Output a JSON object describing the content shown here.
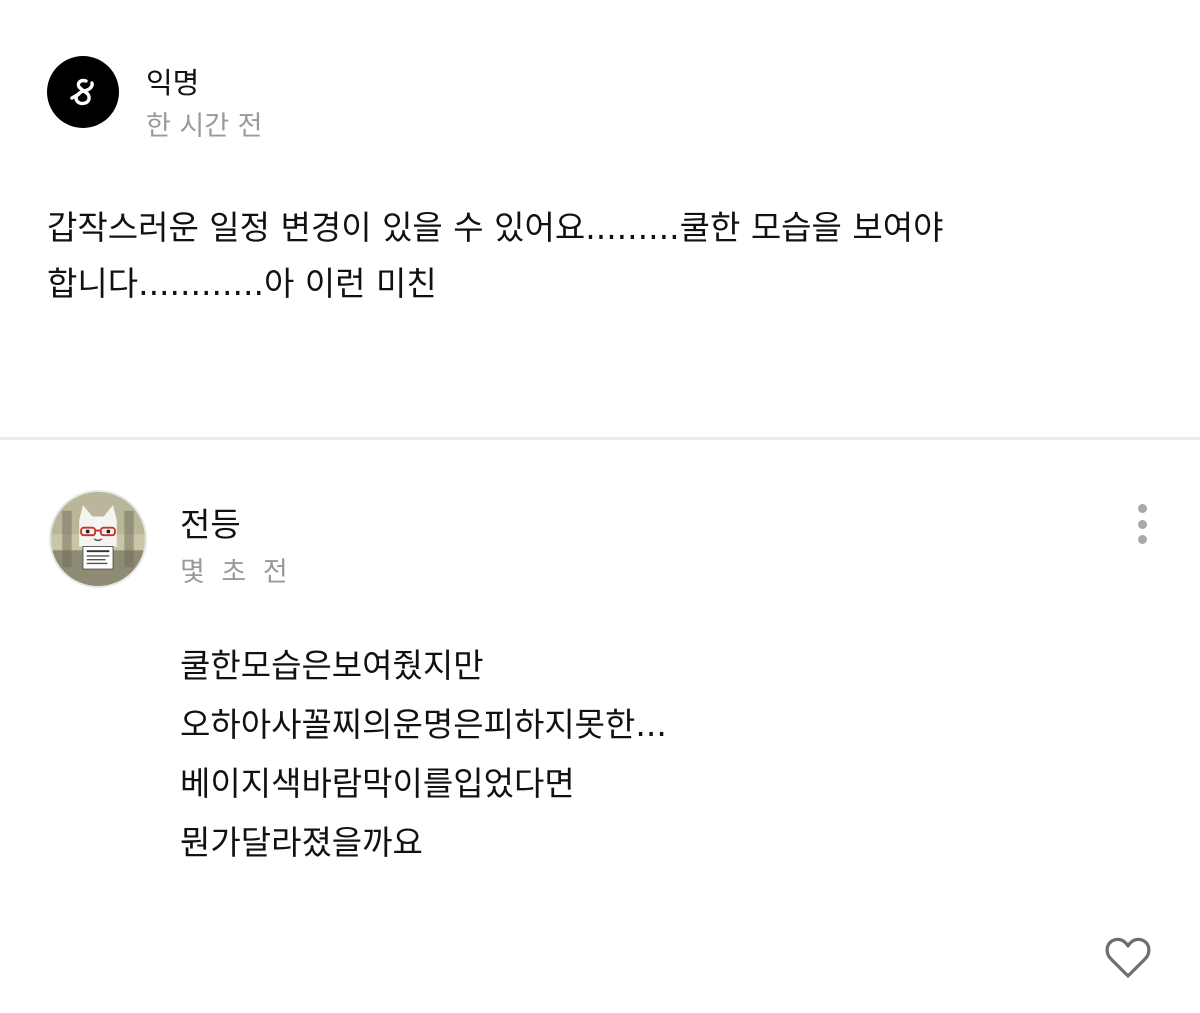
{
  "post": {
    "author": "익명",
    "time": "한 시간 전",
    "body_lines": [
      "갑작스러운 일정 변경이 있을 수 있어요.........쿨한 모습을 보여야",
      "합니다............아 이런 미친"
    ]
  },
  "comment": {
    "author": "전등",
    "time": "몇 초 전",
    "lines": [
      "쿨한모습은보여줬지만",
      "오하아사꼴찌의운명은피하지못한...",
      "베이지색바람막이를입었다면",
      "뭔가달라졌을까요"
    ]
  },
  "icons": {
    "post_avatar": "anonymous-logo-icon",
    "comment_avatar": "cat-character-avatar",
    "more": "more-vertical-icon",
    "like": "heart-outline-icon"
  },
  "colors": {
    "muted_text": "#9a9a9a",
    "divider": "#ececec",
    "icon_gray": "#a8a8a8"
  }
}
